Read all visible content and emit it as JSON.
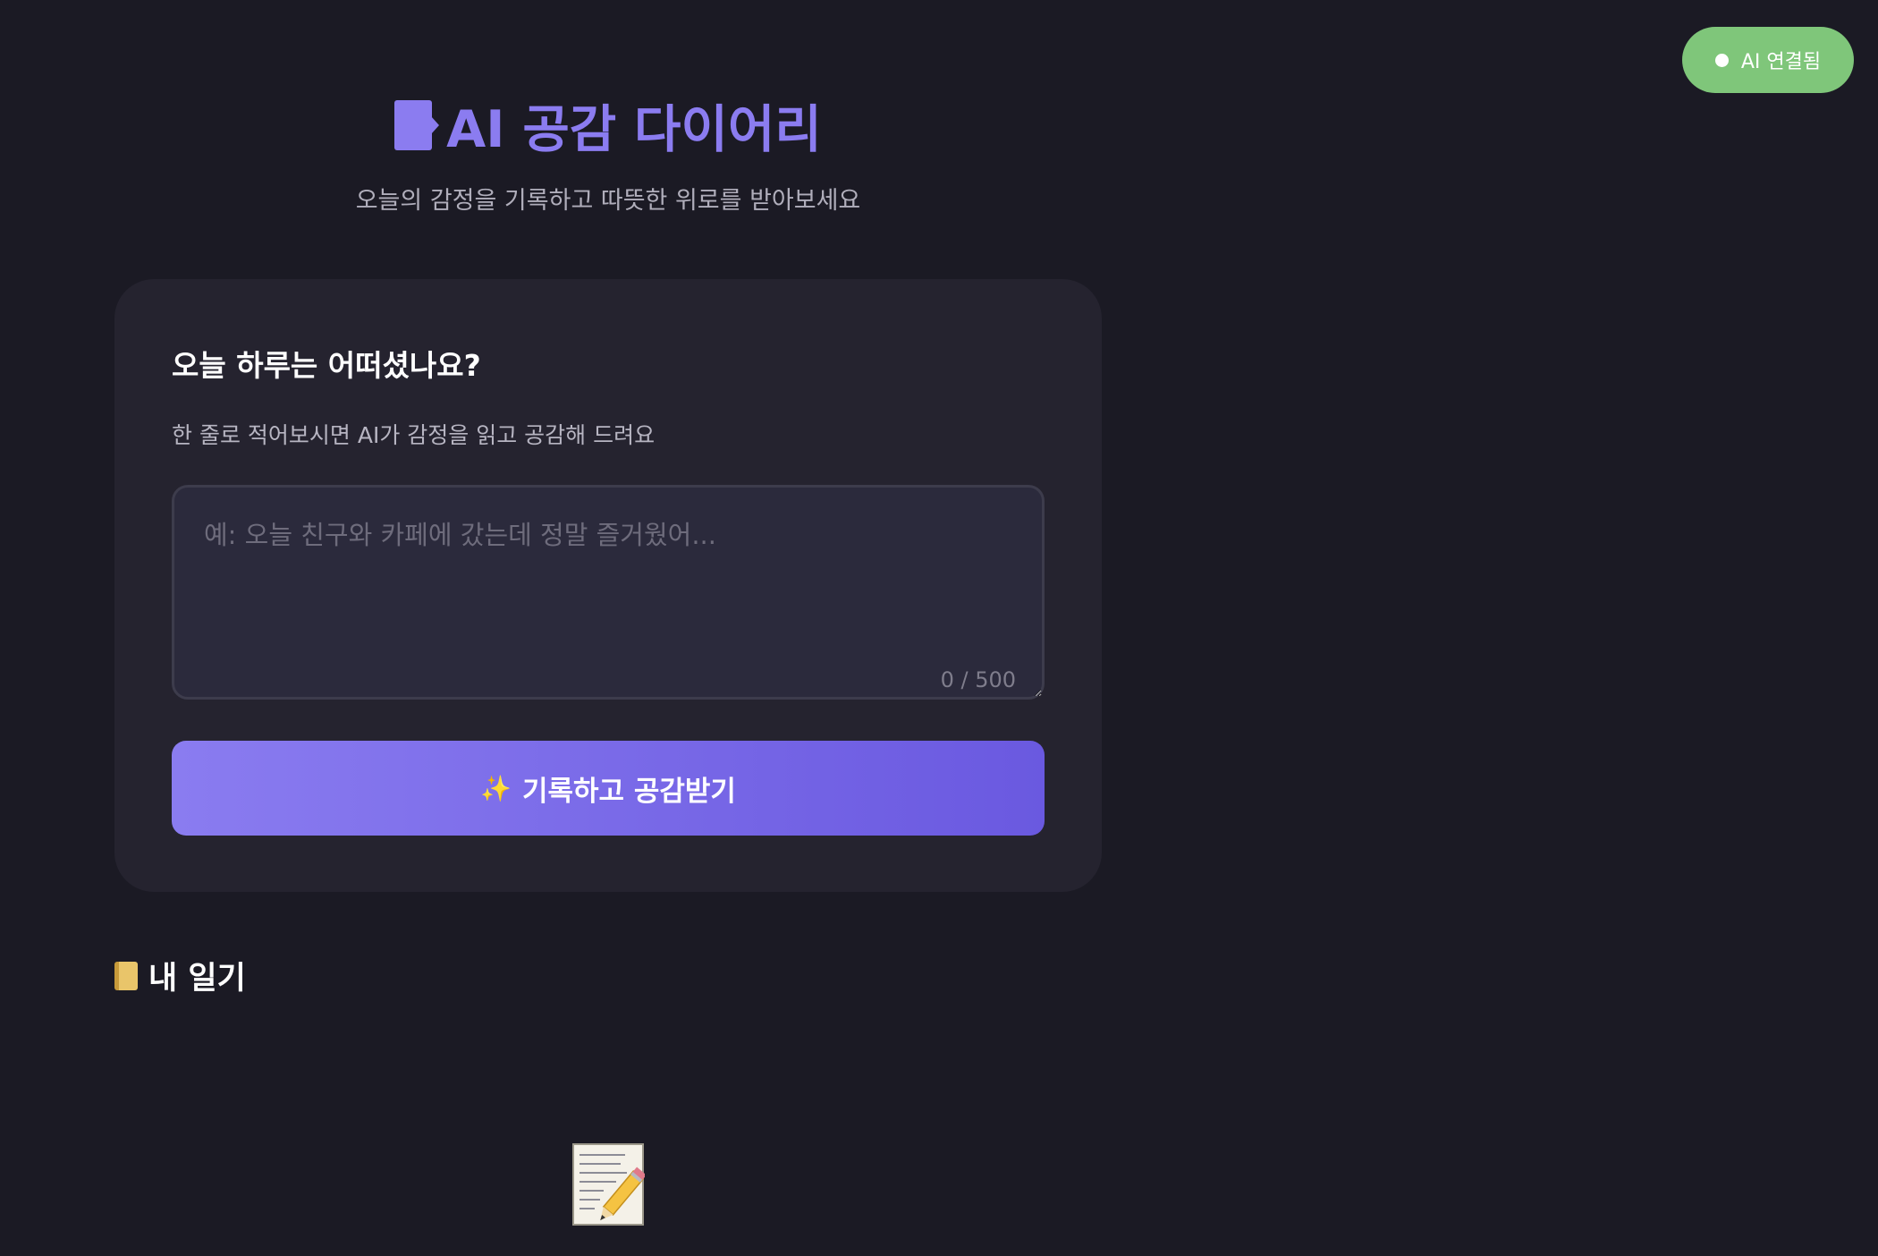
{
  "status": {
    "label": "AI 연결됨",
    "color": "#7fc67a"
  },
  "header": {
    "title": "AI 공감 다이어리",
    "subtitle": "오늘의 감정을 기록하고 따뜻한 위로를 받아보세요",
    "icon": "book-icon"
  },
  "entry_card": {
    "heading": "오늘 하루는 어떠셨나요?",
    "description": "한 줄로 적어보시면 AI가 감정을 읽고 공감해 드려요",
    "input": {
      "value": "",
      "placeholder": "예: 오늘 친구와 카페에 갔는데 정말 즐거웠어...",
      "char_count": "0 / 500"
    },
    "submit": {
      "icon": "sparkle-icon",
      "label": "기록하고 공감받기"
    }
  },
  "diary_section": {
    "icon": "notebook-icon",
    "heading": "내 일기",
    "empty_icon": "memo-icon"
  },
  "colors": {
    "background": "#1b1a24",
    "card": "#25232f",
    "accent": "#8b7cf0",
    "button_start": "#8a7cf0",
    "button_end": "#6a59e0"
  }
}
